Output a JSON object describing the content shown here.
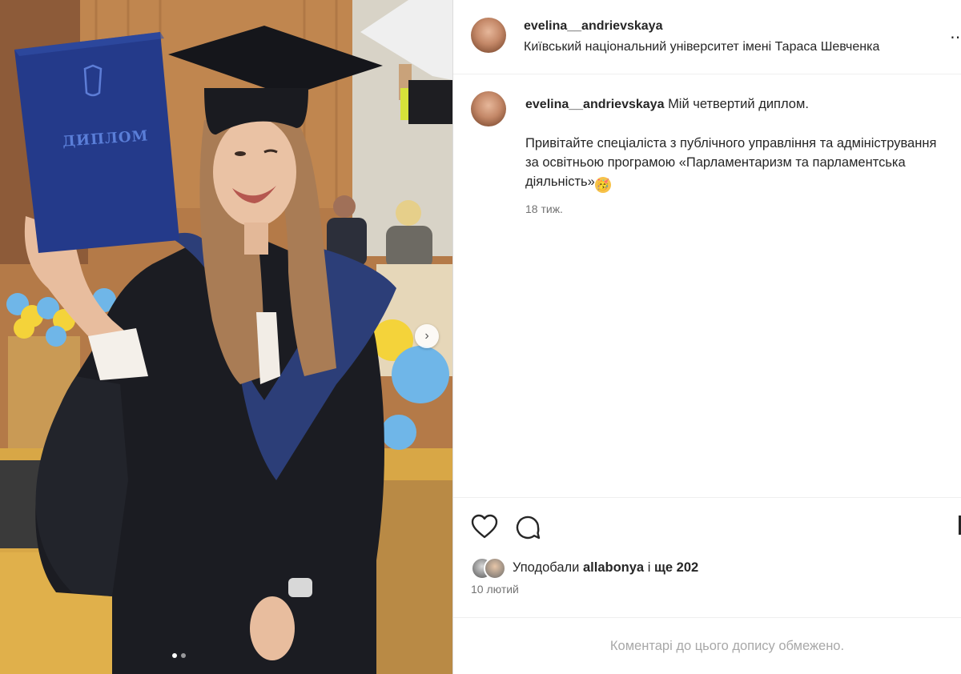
{
  "post": {
    "username": "evelina__andrievskaya",
    "location": "Київський національний університет імені Тараса Шевченка",
    "caption_line1": "Мій четвертий диплом.",
    "caption_line2": "Привітайте спеціаліста з публічного управління та адміністрування за освітньою програмою «Парламентаризм та парламентська діяльність»",
    "caption_emoji": "🥳",
    "time_ago": "18 тиж.",
    "likes_prefix": "Уподобали",
    "likes_user": "allabonya",
    "likes_conj": "і",
    "likes_rest": "ще 202",
    "date": "10 лютий",
    "comments_limited": "Коментарі до цього допису обмежено."
  },
  "media": {
    "diploma_text": "ДИПЛОМ",
    "next_icon": "chevron-right-icon",
    "slides_total": 2,
    "slide_active": 1
  },
  "icons": {
    "like": "heart-icon",
    "comment": "comment-icon",
    "more": "more-icon"
  },
  "colors": {
    "text": "#262626",
    "muted": "#737373",
    "limited": "#a8a8a8",
    "divider": "#efefef",
    "diploma_blue": "#1f3a8f"
  }
}
